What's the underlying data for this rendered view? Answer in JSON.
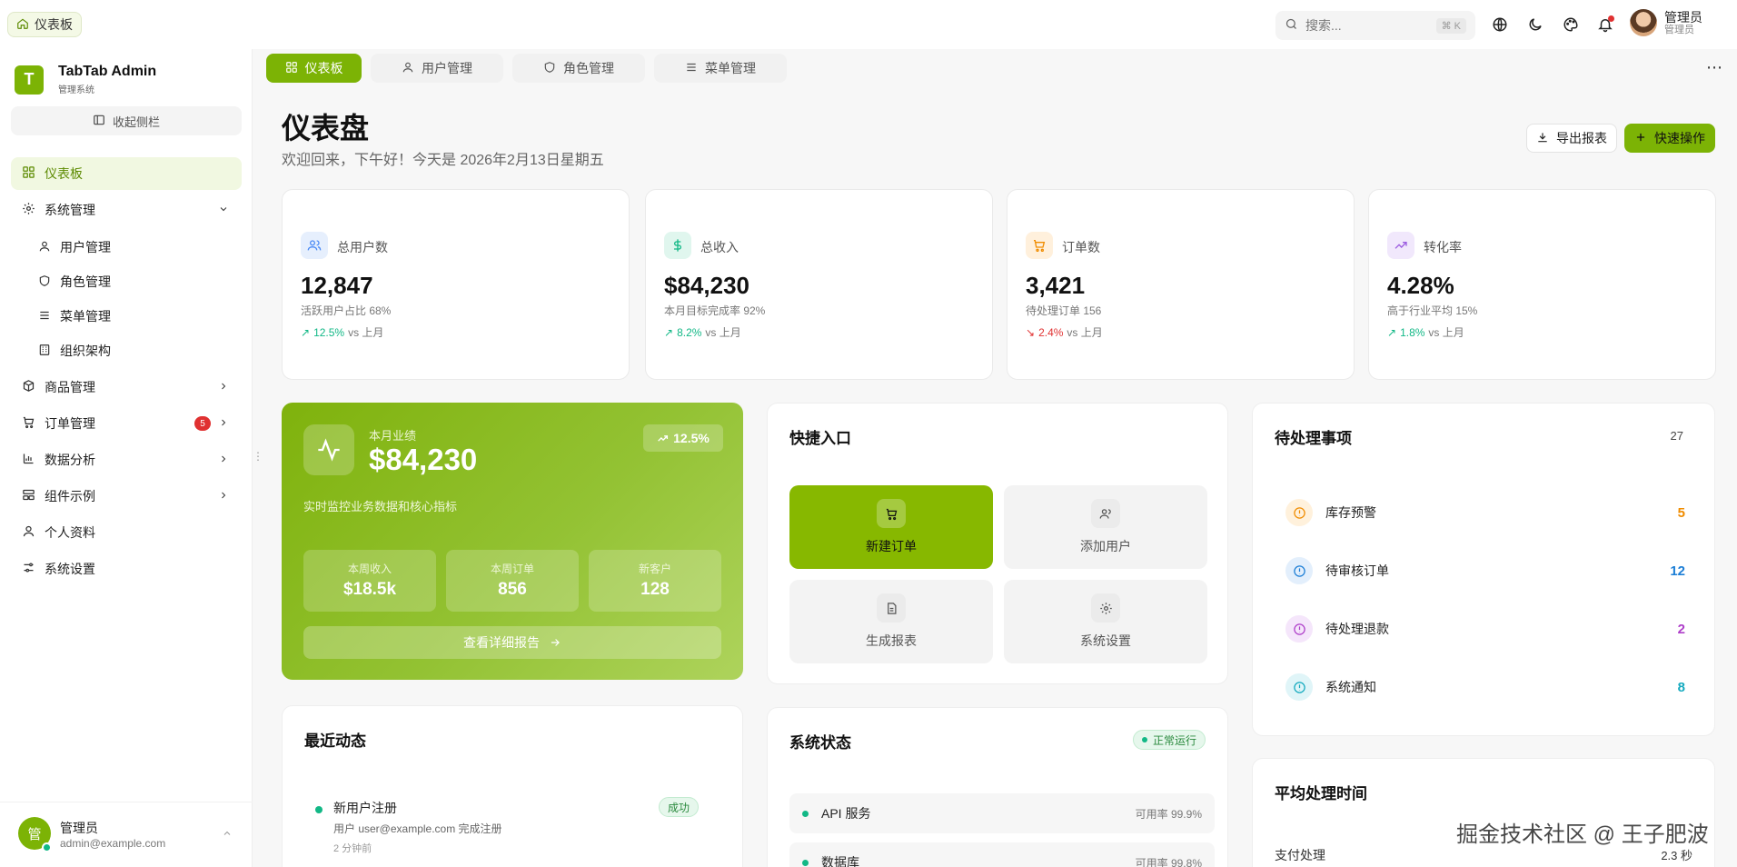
{
  "breadcrumb": {
    "label": "仪表板"
  },
  "topbar": {
    "search_placeholder": "搜索...",
    "search_shortcut": "⌘ K",
    "icons": [
      "globe-icon",
      "moon-icon",
      "palette-icon",
      "bell-icon"
    ],
    "user_name": "管理员",
    "user_role": "管理员"
  },
  "sidebar": {
    "brand_title": "TabTab Admin",
    "brand_subtitle": "管理系统",
    "collapse_label": "收起侧栏",
    "items": [
      {
        "label": "仪表板",
        "icon": "grid-icon",
        "active": true
      },
      {
        "label": "系统管理",
        "icon": "gear-icon",
        "expanded": true
      },
      {
        "label": "商品管理",
        "icon": "box-icon"
      },
      {
        "label": "订单管理",
        "icon": "cart-icon",
        "badge": "5"
      },
      {
        "label": "数据分析",
        "icon": "chart-icon"
      },
      {
        "label": "组件示例",
        "icon": "components-icon"
      },
      {
        "label": "个人资料",
        "icon": "user-icon"
      },
      {
        "label": "系统设置",
        "icon": "sliders-icon"
      }
    ],
    "sub_items": [
      {
        "label": "用户管理",
        "icon": "user-icon"
      },
      {
        "label": "角色管理",
        "icon": "shield-icon"
      },
      {
        "label": "菜单管理",
        "icon": "menu-icon"
      },
      {
        "label": "组织架构",
        "icon": "building-icon"
      }
    ],
    "user": {
      "avatar": "管",
      "name": "管理员",
      "email": "admin@example.com"
    }
  },
  "tabs": [
    {
      "label": "仪表板",
      "active": true
    },
    {
      "label": "用户管理"
    },
    {
      "label": "角色管理"
    },
    {
      "label": "菜单管理"
    }
  ],
  "header": {
    "title": "仪表盘",
    "subtitle": "欢迎回来，下午好！今天是 2026年2月13日星期五",
    "export_label": "导出报表",
    "quick_label": "快速操作"
  },
  "stats": [
    {
      "label": "总用户数",
      "value": "12,847",
      "sub": "活跃用户占比 68%",
      "trend": "12.5%",
      "trend_dir": "up",
      "vs": "vs 上月",
      "color": "#4c8bf5"
    },
    {
      "label": "总收入",
      "value": "$84,230",
      "sub": "本月目标完成率 92%",
      "trend": "8.2%",
      "trend_dir": "up",
      "vs": "vs 上月",
      "color": "#12b886"
    },
    {
      "label": "订单数",
      "value": "3,421",
      "sub": "待处理订单 156",
      "trend": "2.4%",
      "trend_dir": "down",
      "vs": "vs 上月",
      "color": "#f08c00"
    },
    {
      "label": "转化率",
      "value": "4.28%",
      "sub": "高于行业平均 15%",
      "trend": "1.8%",
      "trend_dir": "up",
      "vs": "vs 上月",
      "color": "#9c5de0"
    }
  ],
  "performance": {
    "label": "本月业绩",
    "value": "$84,230",
    "change": "12.5%",
    "description": "实时监控业务数据和核心指标",
    "metrics": [
      {
        "label": "本周收入",
        "value": "$18.5k"
      },
      {
        "label": "本周订单",
        "value": "856"
      },
      {
        "label": "新客户",
        "value": "128"
      }
    ],
    "link_label": "查看详细报告"
  },
  "quick_access": {
    "title": "快捷入口",
    "items": [
      {
        "label": "新建订单",
        "icon": "cart-icon",
        "primary": true
      },
      {
        "label": "添加用户",
        "icon": "users-icon"
      },
      {
        "label": "生成报表",
        "icon": "file-icon"
      },
      {
        "label": "系统设置",
        "icon": "gear-icon"
      }
    ]
  },
  "pending": {
    "title": "待处理事项",
    "count": "27",
    "items": [
      {
        "label": "库存预警",
        "value": "5",
        "color": "#f08c00",
        "bg": "#fff1dc"
      },
      {
        "label": "待审核订单",
        "value": "12",
        "color": "#1c7ed6",
        "bg": "#e3effc"
      },
      {
        "label": "待处理退款",
        "value": "2",
        "color": "#ae3ec9",
        "bg": "#f5e6fb"
      },
      {
        "label": "系统通知",
        "value": "8",
        "color": "#15aabf",
        "bg": "#e0f5f8"
      }
    ]
  },
  "recent": {
    "title": "最近动态",
    "items": [
      {
        "title": "新用户注册",
        "desc": "用户 user@example.com 完成注册",
        "time": "2 分钟前",
        "tag": "成功"
      }
    ]
  },
  "system_status": {
    "title": "系统状态",
    "status": "正常运行",
    "services": [
      {
        "name": "API 服务",
        "uptime": "可用率 99.9%"
      },
      {
        "name": "数据库",
        "uptime": "可用率 99.8%"
      }
    ]
  },
  "avg_time": {
    "title": "平均处理时间",
    "rows": [
      {
        "label": "支付处理",
        "value": "2.3 秒"
      }
    ]
  },
  "watermark": "掘金技术社区 @ 王子肥波",
  "accent": "#7cb305"
}
